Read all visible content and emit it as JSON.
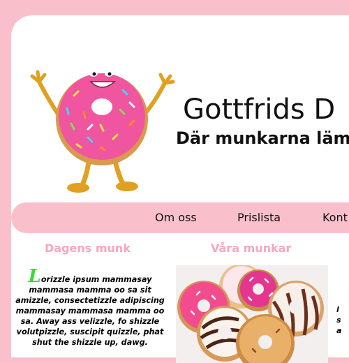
{
  "header": {
    "title": "Gottfrids D",
    "tagline": "Där munkarna lämn"
  },
  "nav": {
    "items": [
      "Om oss",
      "Prislista",
      "Kont"
    ]
  },
  "sections": {
    "todays_donut_heading": "Dagens munk",
    "our_donuts_heading": "Våra munkar"
  },
  "article": {
    "dropcap": "L",
    "text": "orizzle ipsum mammasay mammasa mamma oo sa sit amizzle, consectetizzle adipiscing mammasay mammasa mamma oo sa. Away ass velizzle, fo shizzle volutpizzle, suscipit quizzle, phat shut the shizzle up, dawg."
  },
  "right_column": {
    "text_fragments": [
      "l",
      "s",
      "a"
    ]
  },
  "colors": {
    "background": "#f9c0cc",
    "heading_pink": "#f7a6bf",
    "dropcap_green": "#2fe02f",
    "donut_pink": "#f0559f"
  },
  "icons": {
    "logo": "donut-mascot-icon",
    "photo": "donuts-photo"
  }
}
